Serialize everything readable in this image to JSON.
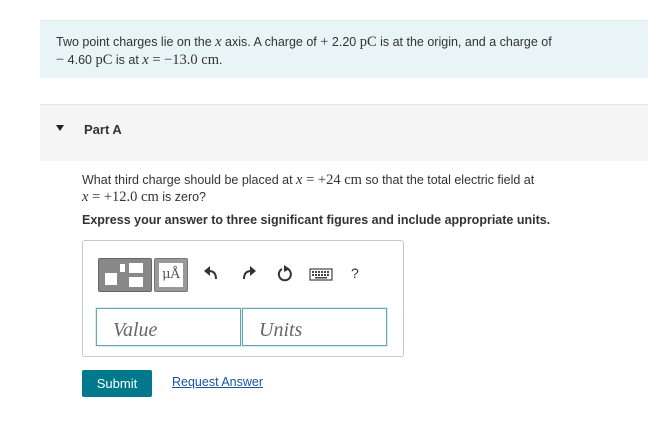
{
  "problem": {
    "text_1": "Two point charges lie on the ",
    "axis_var": "x",
    "text_2": " axis. A charge of ",
    "charge1_sign": "+",
    "charge1_num": " 2.20 ",
    "charge1_unit": "pC",
    "text_3": " is at the origin, and a charge of",
    "charge2_sign": "−",
    "charge2_num": " 4.60 ",
    "charge2_unit": "pC",
    "text_4": " is at ",
    "pos_expr": "= −13.0 cm",
    "text_5": "."
  },
  "part": {
    "title": "Part A"
  },
  "question": {
    "text_1": "What third charge should be placed at ",
    "expr1": "= +24 cm",
    "text_2": " so that the total electric field at",
    "expr2": "= +12.0 cm",
    "text_3": " is zero?"
  },
  "instruction": "Express your answer to three significant figures and include appropriate units.",
  "toolbar": {
    "units_label": "μÅ",
    "help_label": "?"
  },
  "inputs": {
    "value_placeholder": "Value",
    "units_placeholder": "Units"
  },
  "buttons": {
    "submit_label": "Submit",
    "request_label": "Request Answer"
  }
}
